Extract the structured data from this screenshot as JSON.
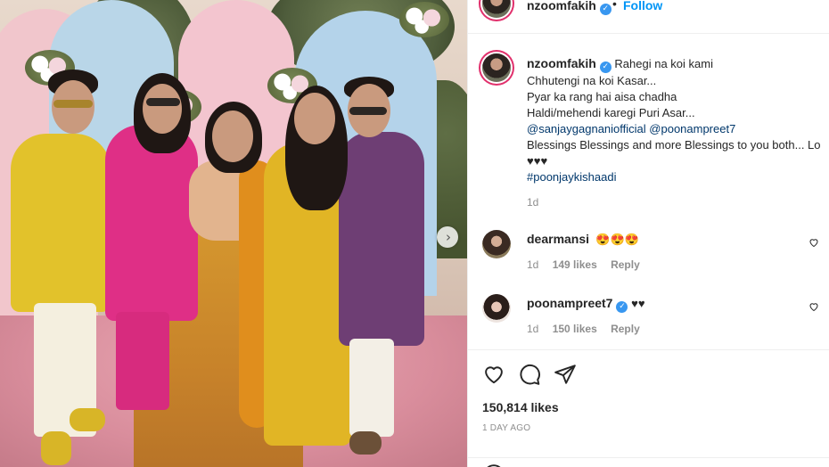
{
  "post": {
    "username": "nzoomfakih",
    "follow_label": "Follow",
    "separator": "•",
    "verified_glyph": "✓",
    "carousel_next_glyph": "›"
  },
  "caption": {
    "username": "nzoomfakih",
    "lines": [
      "Rahegi na koi kami",
      "Chhutengi na koi Kasar...",
      "Pyar ka rang hai aisa chadha",
      "Haldi/mehendi karegi Puri Asar..."
    ],
    "mention_1": "@sanjaygagnaniofficial",
    "mention_2": "@poonampreet7",
    "blessings": "Blessings Blessings and more Blessings to you both... Lo",
    "hearts": "♥♥♥",
    "hashtag": "#poonjaykishaadi",
    "time": "1d"
  },
  "comments": [
    {
      "username": "dearmansi",
      "text": "😍😍😍",
      "time": "1d",
      "likes": "149 likes",
      "reply": "Reply"
    },
    {
      "username": "poonampreet7",
      "text": "♥♥",
      "time": "1d",
      "likes": "150 likes",
      "reply": "Reply"
    }
  ],
  "actions": {
    "likes": "150,814 likes",
    "posted": "1 DAY AGO"
  },
  "icons": {
    "like": "heart-icon",
    "comment": "comment-icon",
    "share": "share-icon",
    "verified": "verified-badge-icon",
    "carousel": "chevron-right-icon"
  },
  "colors": {
    "link_blue": "#0095f6",
    "verified_blue": "#3897f0",
    "mention_navy": "#00376b",
    "muted": "#8e8e8e",
    "text": "#262626"
  }
}
